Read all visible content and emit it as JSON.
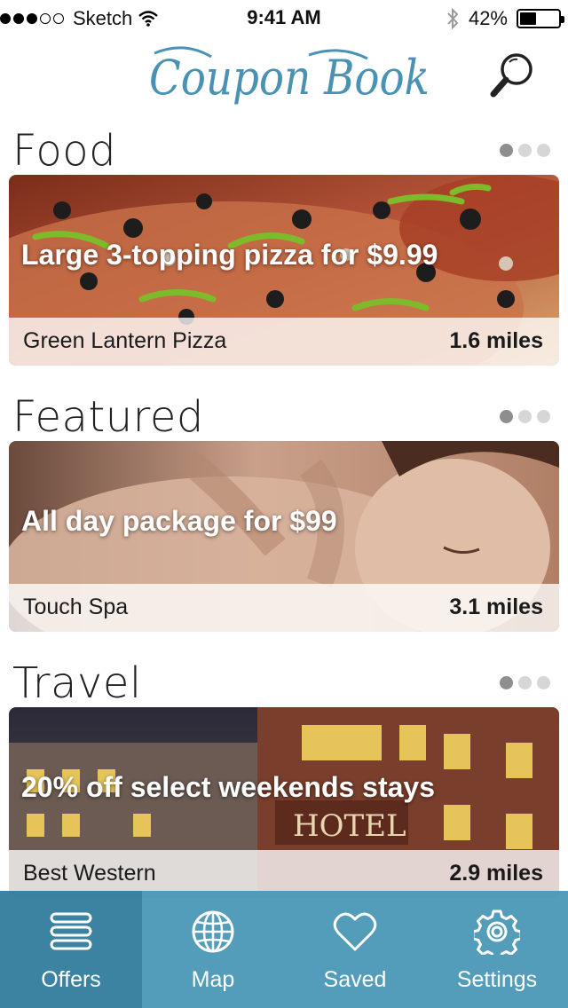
{
  "status_bar": {
    "carrier": "Sketch",
    "signal_bars_filled": 3,
    "signal_bars_total": 5,
    "time": "9:41 AM",
    "battery": "42%",
    "battery_level": 0.42
  },
  "header": {
    "logo_text": "Coupon Book",
    "search_icon": "search-icon"
  },
  "colors": {
    "accent": "#4a92b3",
    "tab_bar": "#4696b6",
    "tab_active": "#33809f"
  },
  "sections": [
    {
      "title": "Food",
      "pager": {
        "pages": 3,
        "active": 0
      },
      "card": {
        "offer": "Large 3-topping pizza for $9.99",
        "merchant": "Green Lantern Pizza",
        "distance": "1.6 miles",
        "image": "pizza"
      }
    },
    {
      "title": "Featured",
      "pager": {
        "pages": 3,
        "active": 0
      },
      "card": {
        "offer": "All day package for $99",
        "merchant": "Touch Spa",
        "distance": "3.1 miles",
        "image": "spa-massage"
      }
    },
    {
      "title": "Travel",
      "pager": {
        "pages": 3,
        "active": 0
      },
      "card": {
        "offer": "20% off select weekends stays",
        "merchant": "Best Western",
        "distance": "2.9 miles",
        "image": "hotel"
      }
    }
  ],
  "tabs": [
    {
      "label": "Offers",
      "icon": "menu-icon",
      "active": true
    },
    {
      "label": "Map",
      "icon": "globe-icon",
      "active": false
    },
    {
      "label": "Saved",
      "icon": "heart-icon",
      "active": false
    },
    {
      "label": "Settings",
      "icon": "gear-icon",
      "active": false
    }
  ]
}
